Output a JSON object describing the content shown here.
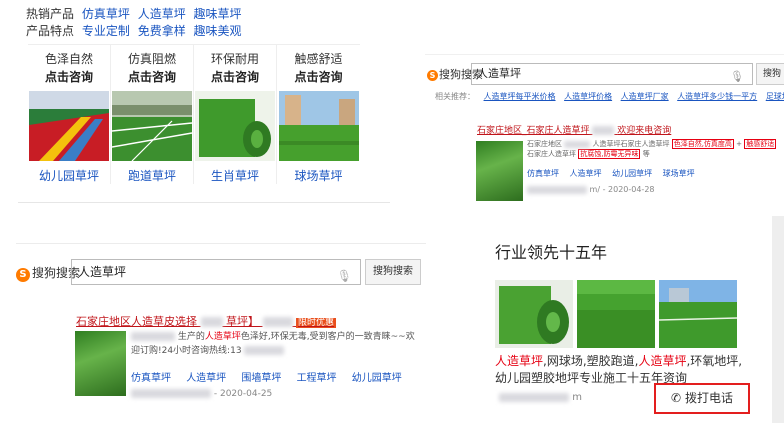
{
  "panel1": {
    "hot_label": "热销产品",
    "hot_links": [
      "仿真草坪",
      "人造草坪",
      "趣味草坪"
    ],
    "feature_label": "产品特点",
    "feature_links": [
      "专业定制",
      "免费拿样",
      "趣味美观"
    ],
    "cards": [
      {
        "feature": "色泽自然",
        "cta": "点击咨询",
        "caption": "幼儿园草坪"
      },
      {
        "feature": "仿真阻燃",
        "cta": "点击咨询",
        "caption": "跑道草坪"
      },
      {
        "feature": "环保耐用",
        "cta": "点击咨询",
        "caption": "生肖草坪"
      },
      {
        "feature": "触感舒适",
        "cta": "点击咨询",
        "caption": "球场草坪"
      }
    ]
  },
  "panel2": {
    "logo": "搜狗搜索",
    "logo_s": "S",
    "query": "人造草坪",
    "mic": "🎙",
    "search_button": "搜狗",
    "related_label": "相关推荐：",
    "related": [
      "人造草坪每平米价格",
      "人造草坪价格",
      "人造草坪厂家",
      "人造草坪多少钱一平方",
      "足球场人"
    ],
    "title_a": "石家庄地区_石家庄人造草坪",
    "title_b": "欢迎来电咨询",
    "desc_a": "石家庄地区",
    "desc_b": "人造草坪石家庄人造草坪",
    "box1": "色泽自然,仿真度高",
    "box_sep": "+",
    "box2": "触感舒适",
    "desc_c": "石家庄人造草坪",
    "box3": "抗腐蚀,防霉无异味",
    "desc_d": "等",
    "tags": [
      "仿真草坪",
      "人造草坪",
      "幼儿园草坪",
      "球场草坪"
    ],
    "meta": "m/ - 2020-04-28"
  },
  "panel3": {
    "logo": "搜狗搜索",
    "logo_s": "S",
    "query": "人造草坪",
    "mic": "🎙",
    "search_button": "搜狗搜索",
    "title": "石家庄地区人造草皮选择",
    "title_tail": "草坪】",
    "badge": "限时优惠",
    "desc_a": "生产的",
    "desc_red": "人造草坪",
    "desc_b": "色泽好,环保无毒,受到客户的一致青睐~~欢迎订购!24小时咨询热线:13",
    "tags": [
      "仿真草坪",
      "人造草坪",
      "围墙草坪",
      "工程草坪",
      "幼儿园草坪"
    ],
    "meta": "- 2020-04-25"
  },
  "panel4": {
    "headline": "行业领先十五年",
    "desc_red1": "人造草坪",
    "desc_mid": ",网球场,塑胶跑道,",
    "desc_red2": "人造草坪",
    "desc_end": ",环氧地坪,幼儿园塑胶地坪专业施工十五年资询",
    "meta": "m",
    "call_button": "拨打电话",
    "phone_icon": "phone-icon"
  }
}
